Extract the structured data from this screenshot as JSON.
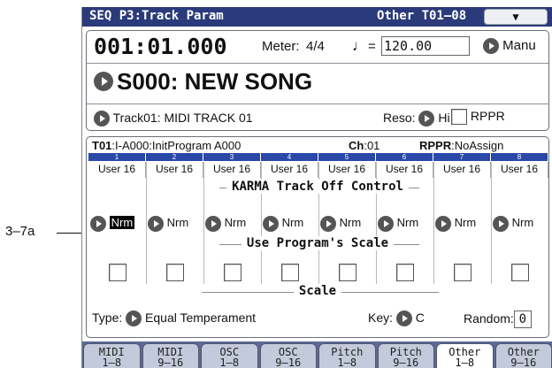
{
  "callout": "3–7a",
  "titlebar": {
    "title": "SEQ P3:Track Param",
    "right": "Other T01–08",
    "menu_icon": "chevron-down"
  },
  "locator": {
    "position": "001:01.000",
    "meter_label": "Meter:",
    "meter": "4/4",
    "tempo_eq": "=",
    "tempo": "120.00",
    "tempo_mode": "Manu"
  },
  "song": {
    "name": "S000: NEW SONG"
  },
  "track": {
    "label": "Track01: MIDI TRACK 01",
    "reso_label": "Reso:",
    "reso": "Hi",
    "rppr_label": "RPPR"
  },
  "info": {
    "track": "T01",
    "program": ":I-A000:InitProgram A000",
    "ch_label": "Ch",
    "ch": ":01",
    "rppr_label": "RPPR",
    "rppr": ":NoAssign"
  },
  "columns": [
    "1",
    "2",
    "3",
    "4",
    "5",
    "6",
    "7",
    "8"
  ],
  "users": [
    "User 16",
    "User 16",
    "User 16",
    "User 16",
    "User 16",
    "User 16",
    "User 16",
    "User 16"
  ],
  "karma": {
    "title": "KARMA Track Off Control",
    "values": [
      "Nrm",
      "Nrm",
      "Nrm",
      "Nrm",
      "Nrm",
      "Nrm",
      "Nrm",
      "Nrm"
    ]
  },
  "use_scale": {
    "title": "Use Program's Scale"
  },
  "scale": {
    "title": "Scale",
    "type_label": "Type:",
    "type": "Equal Temperament",
    "key_label": "Key:",
    "key": "C",
    "random_label": "Random:",
    "random": "0"
  },
  "tabs": [
    {
      "l1": "MIDI",
      "l2": "1–8"
    },
    {
      "l1": "MIDI",
      "l2": "9–16"
    },
    {
      "l1": "OSC",
      "l2": "1–8"
    },
    {
      "l1": "OSC",
      "l2": "9–16"
    },
    {
      "l1": "Pitch",
      "l2": "1–8"
    },
    {
      "l1": "Pitch",
      "l2": "9–16"
    },
    {
      "l1": "Other",
      "l2": "1–8"
    },
    {
      "l1": "Other",
      "l2": "9–16"
    }
  ],
  "colors": {
    "titlebar": "#2a3a7a",
    "column_header": "#2a48a8",
    "tabbar": "#5a6a9a"
  }
}
